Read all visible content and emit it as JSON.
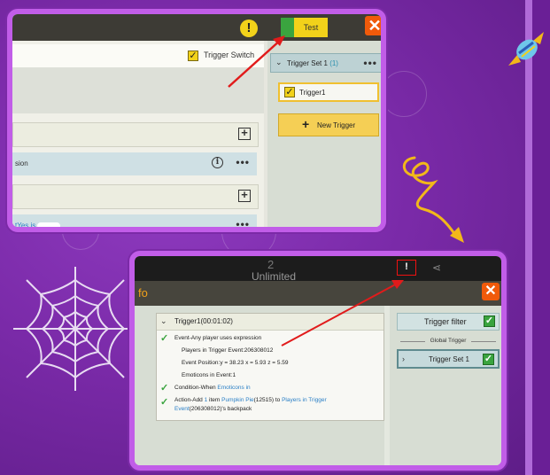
{
  "panel1": {
    "warning_glyph": "!",
    "test_button": "Test",
    "close_glyph": "✕",
    "trigger_switch_label": "Trigger Switch",
    "rows": [
      {
        "text": ""
      },
      {
        "text": "sion"
      },
      {
        "text": ""
      },
      {
        "text": "tYes is"
      }
    ],
    "trigger_set": {
      "label": "Trigger Set 1",
      "count": "(1)"
    },
    "trigger1_label": "Trigger1",
    "new_trigger": "New Trigger"
  },
  "panel2": {
    "game_number": "2",
    "game_text": "Unlimited",
    "exclaim_glyph": "!",
    "title_fragment": "fo",
    "close_glyph": "✕",
    "trigger_header": "Trigger1(00:01:02)",
    "event_line": "Event-Any player uses expression",
    "details": [
      "Players in Trigger Event:206308012",
      "Event Position:y = 38.23  x = 5.93  z = 5.59",
      "Emoticons in Event:1"
    ],
    "condition": {
      "prefix": "Condition-When ",
      "highlight": "Emoticons in"
    },
    "action": {
      "part1": "Action-Add ",
      "hl1": "1",
      "part2": " item ",
      "hl2": "Pumpkin  Pie",
      "part3": "(12515) to ",
      "hl3": "Players in Trigger",
      "hl4": "Event",
      "part4": "(206308012)'s backpack"
    },
    "trigger_filter": "Trigger filter",
    "global_trigger": "Global Trigger",
    "trigger_set_label": "Trigger Set 1"
  },
  "colors": {
    "accent_yellow": "#f2d21a",
    "close_orange": "#f05a0a",
    "check_green": "#3aa43f",
    "annotation_red": "#e11b1b",
    "frame_purple": "#c15de8"
  }
}
